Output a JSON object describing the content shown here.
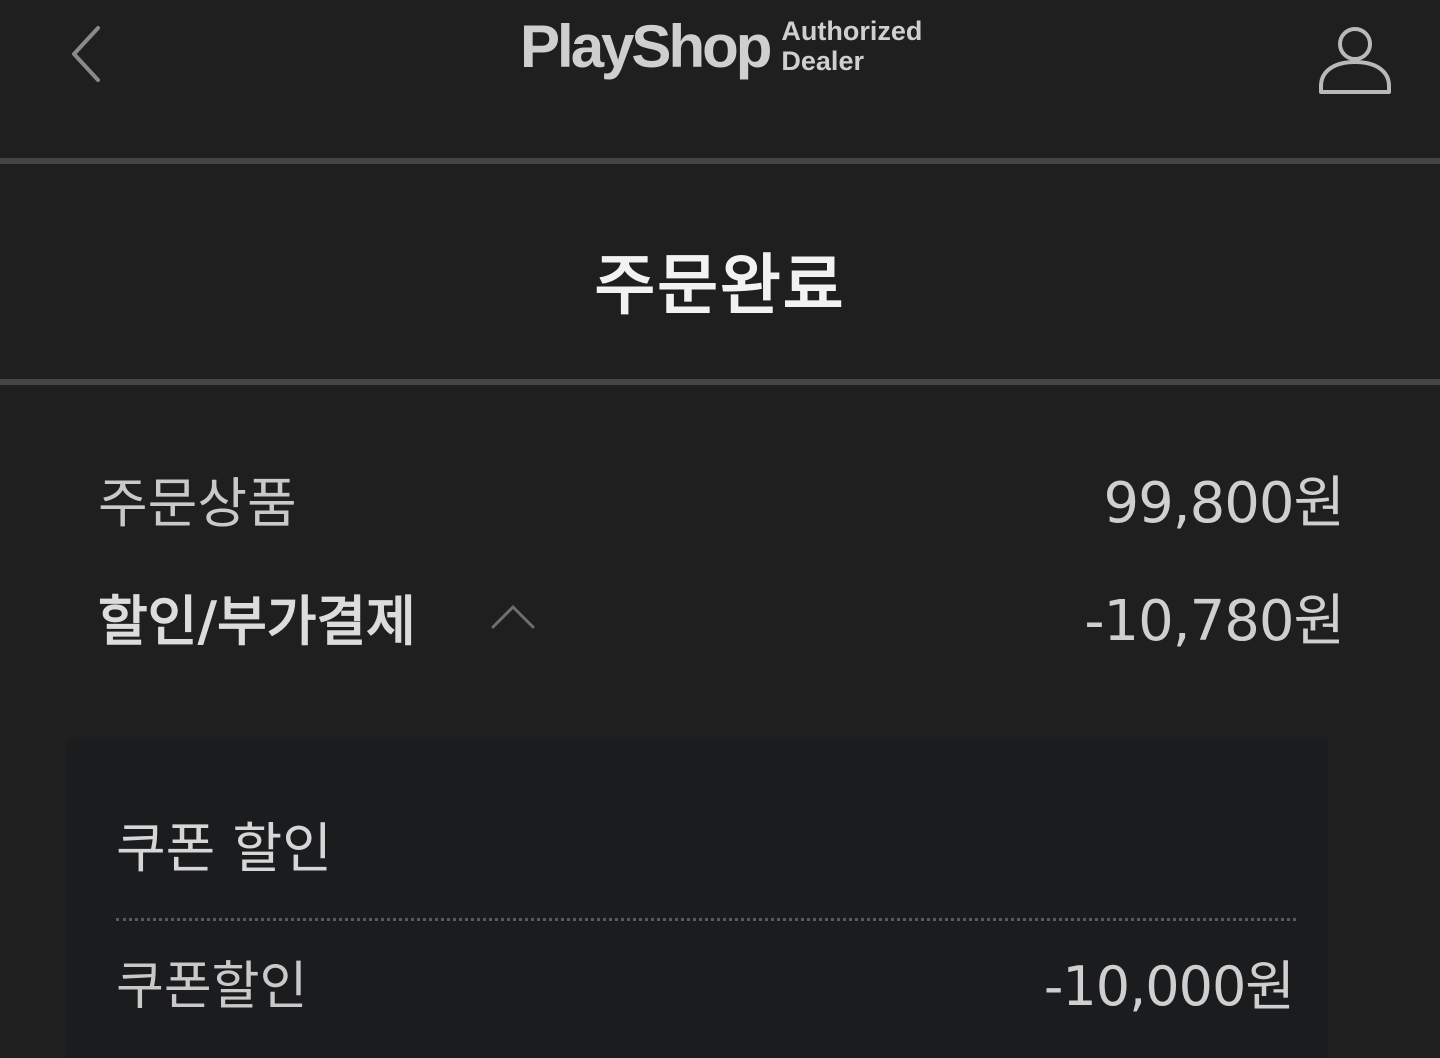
{
  "header": {
    "logo_text": "PlayShop",
    "logo_sub_line1": "Authorized",
    "logo_sub_line2": "Dealer"
  },
  "page_title": "주문완료",
  "summary": {
    "products_label": "주문상품",
    "products_value": "99,800원",
    "discount_label": "할인/부가결제",
    "discount_value": "-10,780원"
  },
  "detail": {
    "section_title": "쿠폰 할인",
    "items": [
      {
        "label": "쿠폰할인",
        "value": "-10,000원"
      }
    ]
  }
}
